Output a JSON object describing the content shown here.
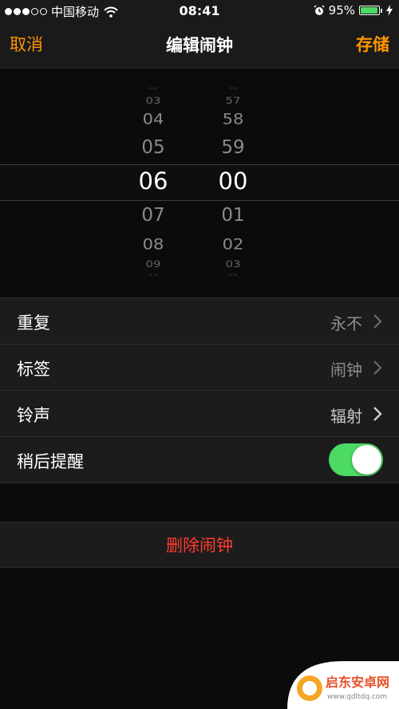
{
  "status_bar": {
    "carrier": "中国移动",
    "time": "08:41",
    "battery": "95%",
    "battery_level": 0.95,
    "signal_bars": 3,
    "signal_total": 5
  },
  "nav": {
    "cancel_label": "取消",
    "title": "编辑闹钟",
    "save_label": "存储"
  },
  "picker": {
    "hours": [
      "02",
      "03",
      "04",
      "05",
      "06",
      "07",
      "08",
      "09",
      "10"
    ],
    "minutes": [
      "56",
      "57",
      "58",
      "59",
      "00",
      "01",
      "02",
      "03",
      "04"
    ],
    "selected_hour": "06",
    "selected_minute": "00"
  },
  "settings": {
    "repeat_label": "重复",
    "repeat_value": "永不",
    "label_label": "标签",
    "label_value": "闹钟",
    "sound_label": "铃声",
    "sound_value": "辐射",
    "snooze_label": "稍后提醒",
    "snooze_on": true
  },
  "delete_label": "删除闹钟",
  "watermark": {
    "name": "启东安卓网",
    "url": "www.qdltdq.com"
  },
  "colors": {
    "accent": "#ff9500",
    "destructive": "#ff3b30",
    "toggle_on": "#4cd964"
  }
}
